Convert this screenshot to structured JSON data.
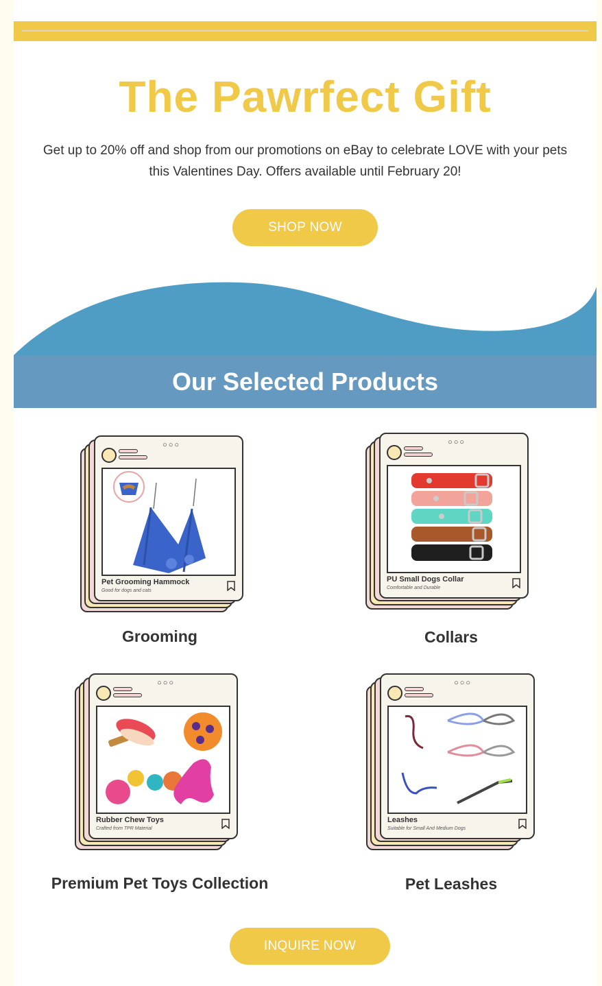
{
  "header": {
    "title": "The Pawrfect Gift",
    "intro": "Get up to 20% off and shop from our promotions on eBay to celebrate LOVE with your pets this Valentines Day. Offers available until February 20!",
    "shop_label": "SHOP NOW"
  },
  "section": {
    "title": "Our Selected Products"
  },
  "products": [
    {
      "name": "Pet Grooming Hammock",
      "subtitle": "Good for dogs and cats",
      "category": "Grooming"
    },
    {
      "name": "PU Small Dogs Collar",
      "subtitle": "Comfortable and Durable",
      "category": "Collars"
    },
    {
      "name": "Rubber Chew Toys",
      "subtitle": "Crafted from TPR Material",
      "category": "Premium Pet Toys Collection"
    },
    {
      "name": "Leashes",
      "subtitle": "Suitable for Small And Medium Dogs",
      "category": "Pet Leashes"
    }
  ],
  "footer": {
    "inquire_label": "INQUIRE NOW"
  },
  "colors": {
    "accent": "#f0c948",
    "band": "#6699bf",
    "wave": "#4f9dc4"
  },
  "icons": [
    "bookmark-icon",
    "dots-icon",
    "avatar-icon"
  ]
}
